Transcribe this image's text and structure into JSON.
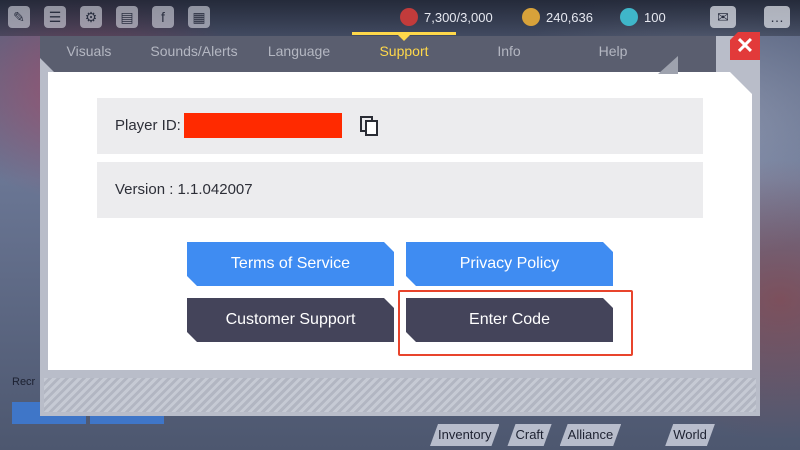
{
  "top_bar": {
    "stamina": "7,300/3,000",
    "coins": "240,636",
    "gems": "100"
  },
  "bottom_nav": [
    "Inventory",
    "Craft",
    "Alliance",
    "World"
  ],
  "left_fragment": "Recr",
  "settings": {
    "tabs": [
      "Visuals",
      "Sounds/Alerts",
      "Language",
      "Support",
      "Info",
      "Help"
    ],
    "active_tab": "Support",
    "player_id_label": "Player ID:",
    "version_text": "Version : 1.1.042007",
    "buttons": {
      "terms": "Terms of Service",
      "privacy": "Privacy Policy",
      "customer_support": "Customer Support",
      "enter_code": "Enter Code"
    }
  },
  "colors": {
    "accent_tab": "#ffd84a",
    "primary_button": "#3f8cf2",
    "secondary_button": "#44445a",
    "close": "#e23a3a",
    "highlight": "#e8442c",
    "redaction": "#ff2a00"
  },
  "icons": {
    "close": "close-icon",
    "copy": "copy-icon",
    "mail": "mail-icon",
    "chat": "chat-icon"
  }
}
